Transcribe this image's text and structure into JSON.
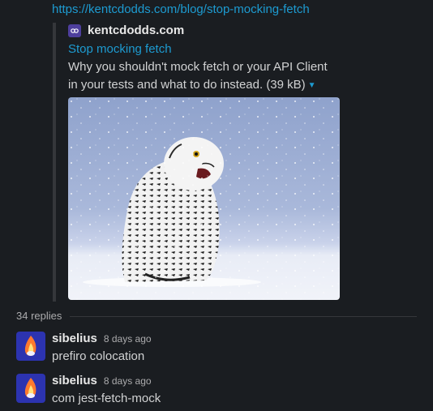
{
  "message": {
    "link_url": "https://kentcdodds.com/blog/stop-mocking-fetch"
  },
  "unfurl": {
    "site_name": "kentcdodds.com",
    "favicon_icon": "kentcdodds-favicon-icon",
    "title": "Stop mocking fetch",
    "description": "Why you shouldn't mock fetch or your API Client in your tests and what to do instead. (39 kB)",
    "image_description": "snowy-owl-in-snow",
    "expand_icon": "caret-down-icon"
  },
  "thread": {
    "replies_label": "34 replies",
    "replies": [
      {
        "author": "sibelius",
        "time": "8 days ago",
        "text": "prefiro colocation"
      },
      {
        "author": "sibelius",
        "time": "8 days ago",
        "text": "com jest-fetch-mock"
      }
    ]
  },
  "colors": {
    "background": "#1a1d21",
    "link": "#1d9bd1",
    "text": "#d1d2d3",
    "muted": "#ababad",
    "avatar_bg": "#2c33b0"
  }
}
